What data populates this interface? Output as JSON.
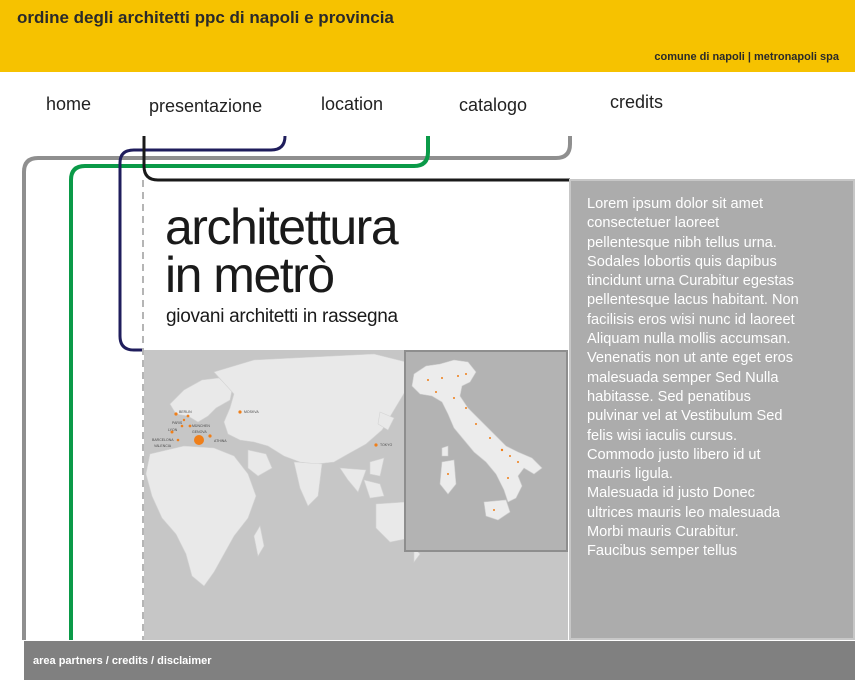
{
  "header": {
    "title": "ordine degli architetti ppc di napoli e provincia",
    "links": "comune di napoli | metronapoli spa"
  },
  "nav": {
    "home": "home",
    "presentazione": "presentazione",
    "location": "location",
    "catalogo": "catalogo",
    "credits": "credits"
  },
  "hero": {
    "title_line1": "architettura",
    "title_line2": "in metrò",
    "subtitle": "giovani architetti in rassegna"
  },
  "body_text": "Lorem ipsum dolor sit amet\nconsectetuer laoreet\npellentesque nibh tellus urna.\nSodales lobortis quis dapibus\ntincidunt urna Curabitur egestas\npellentesque lacus habitant. Non\nfacilisis eros wisi nunc id laoreet\nAliquam nulla mollis accumsan.\nVenenatis non ut ante eget eros\nmalesuada semper Sed Nulla\nhabitasse. Sed penatibus\npulvinar vel at Vestibulum Sed\nfelis wisi iaculis cursus.\nCommodo justo libero id ut\nmauris ligula.\nMalesuada id justo Donec\nultrices mauris leo malesuada\nMorbi mauris Curabitur.\nFaucibus semper tellus",
  "footer": {
    "text": "area partners / credits / disclaimer"
  },
  "map_labels": {
    "berlin": "BERLIN",
    "paris": "PARIS",
    "munchen": "MÜNCHEN",
    "lyon": "LYON",
    "genova": "GENOVA",
    "barcelona": "BARCELONA",
    "valencia": "VALENCIA",
    "athina": "ATHINA",
    "moskva": "MOSKVA",
    "tokyo": "TOKYO",
    "napoli": "NAPOLI"
  },
  "colors": {
    "header_bg": "#f6c200",
    "line_gray": "#8f8f8f",
    "line_green": "#0a9a48",
    "line_navy": "#1f1d5c",
    "line_black": "#1a1a1a",
    "marker_orange": "#ef7f1a"
  }
}
